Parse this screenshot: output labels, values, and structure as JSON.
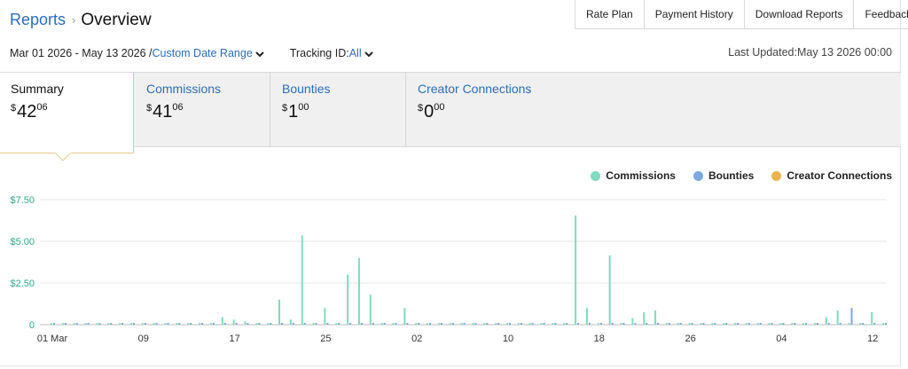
{
  "header": {
    "breadcrumb_root": "Reports",
    "breadcrumb_sep": "›",
    "title": "Overview",
    "nav": [
      "Rate Plan",
      "Payment History",
      "Download Reports",
      "Feedback"
    ]
  },
  "filters": {
    "date_range": "Mar 01 2026 - May 13 2026 /",
    "date_link": "Custom Date Range",
    "tracking_label": "Tracking ID:",
    "tracking_value": "All",
    "last_updated": "Last Updated:May 13 2026 00:00"
  },
  "tabs": [
    {
      "label": "Summary",
      "currency": "$",
      "whole": "42",
      "cents": "06"
    },
    {
      "label": "Commissions",
      "currency": "$",
      "whole": "41",
      "cents": "06"
    },
    {
      "label": "Bounties",
      "currency": "$",
      "whole": "1",
      "cents": "00"
    },
    {
      "label": "Creator Connections",
      "currency": "$",
      "whole": "0",
      "cents": "00"
    }
  ],
  "colors": {
    "commissions": "#7fdcc0",
    "bounties": "#7aa8e0",
    "creator_connections": "#e9b44c",
    "link": "#2a6ebb",
    "y_ticks": "#2fa98a"
  },
  "chart_data": {
    "type": "bar",
    "legend": [
      "Commissions",
      "Bounties",
      "Creator Connections"
    ],
    "legend_position": "top-right",
    "ylim": [
      0,
      7.5
    ],
    "y_ticks": [
      "$7.50",
      "$5.00",
      "$2.50",
      "0"
    ],
    "y_tick_values": [
      7.5,
      5,
      2.5,
      0
    ],
    "x_ticks": [
      "01 Mar",
      "09",
      "17",
      "25",
      "02",
      "10",
      "18",
      "26",
      "04",
      "12"
    ],
    "x_tick_index": [
      0,
      8,
      16,
      24,
      32,
      40,
      48,
      56,
      64,
      72
    ],
    "categories_count": 74,
    "series": [
      {
        "name": "Commissions",
        "values": [
          0.1,
          0.1,
          0.1,
          0.1,
          0.1,
          0.1,
          0.1,
          0.1,
          0.1,
          0.1,
          0.1,
          0.1,
          0.1,
          0.1,
          0.1,
          0.45,
          0.3,
          0.2,
          0.1,
          0.1,
          1.5,
          0.3,
          5.35,
          0.1,
          1.0,
          0.1,
          3.0,
          4.0,
          1.8,
          0.1,
          0.1,
          1.0,
          0.1,
          0.1,
          0.1,
          0.1,
          0.1,
          0.1,
          0.1,
          0.1,
          0.1,
          0.1,
          0.1,
          0.1,
          0.1,
          0.1,
          6.55,
          1.0,
          0.1,
          4.15,
          0.1,
          0.4,
          0.75,
          0.85,
          0.1,
          0.1,
          0.1,
          0.1,
          0.1,
          0.1,
          0.1,
          0.1,
          0.1,
          0.1,
          0.1,
          0.1,
          0.1,
          0.1,
          0.45,
          0.85,
          0.1,
          0.1,
          0.75,
          0.1
        ]
      },
      {
        "name": "Bounties",
        "values": [
          0,
          0,
          0,
          0,
          0,
          0,
          0,
          0,
          0,
          0,
          0,
          0,
          0,
          0,
          0,
          0,
          0,
          0,
          0,
          0,
          0,
          0,
          0,
          0,
          0,
          0,
          0,
          0,
          0,
          0,
          0,
          0,
          0,
          0,
          0,
          0,
          0,
          0,
          0,
          0,
          0,
          0,
          0,
          0,
          0,
          0,
          0,
          0,
          0,
          0,
          0,
          0,
          0,
          0,
          0,
          0,
          0,
          0,
          0,
          0,
          0,
          0,
          0,
          0,
          0,
          0,
          0,
          0,
          0,
          0,
          1.0,
          0,
          0,
          0
        ]
      },
      {
        "name": "Creator Connections",
        "values": []
      }
    ]
  }
}
